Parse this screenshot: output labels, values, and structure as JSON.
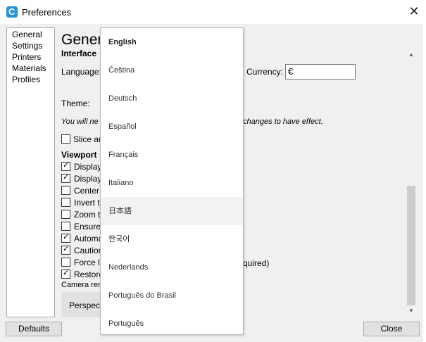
{
  "window": {
    "title": "Preferences",
    "close_glyph": "✕",
    "app_icon": "C"
  },
  "sidebar": {
    "items": [
      {
        "label": "General"
      },
      {
        "label": "Settings"
      },
      {
        "label": "Printers"
      },
      {
        "label": "Materials"
      },
      {
        "label": "Profiles"
      }
    ]
  },
  "general": {
    "title": "General",
    "interface_heading": "Interface",
    "language_label": "Language:",
    "currency_label": "Currency:",
    "currency_value": "€",
    "theme_label": "Theme:",
    "restart_note": "You will ne",
    "restart_note_tail": "changes to have effect.",
    "slice_label": "Slice au",
    "viewport_heading": "Viewport",
    "viewport_options": [
      {
        "label": "Display",
        "checked": true
      },
      {
        "label": "Display",
        "checked": true
      },
      {
        "label": "Center",
        "checked": false
      },
      {
        "label": "Invert t",
        "checked": false
      },
      {
        "label": "Zoom to",
        "checked": false
      },
      {
        "label": "Ensure",
        "checked": false
      },
      {
        "label": "Automa",
        "checked": true
      },
      {
        "label": "Caution",
        "checked": true
      },
      {
        "label": "Force la",
        "checked": false
      },
      {
        "label": "Restore",
        "checked": true
      }
    ],
    "force_tail": "quired)",
    "camera_label": "Camera ren",
    "perspective_label": "Perspect"
  },
  "buttons": {
    "defaults": "Defaults",
    "close": "Close"
  },
  "language_dropdown": {
    "selected": "English",
    "hovered": "日本語",
    "options": [
      "English",
      "Čeština",
      "Deutsch",
      "Español",
      "Français",
      "Italiano",
      "日本語",
      "한국어",
      "Nederlands",
      "Português do Brasil",
      "Português"
    ]
  },
  "colors": {
    "accent": "#2196d9",
    "hover": "#f2f2f2"
  },
  "icons": {
    "checkbox_mark": "✓",
    "scroll_up": "▲",
    "scroll_down": "▼"
  }
}
